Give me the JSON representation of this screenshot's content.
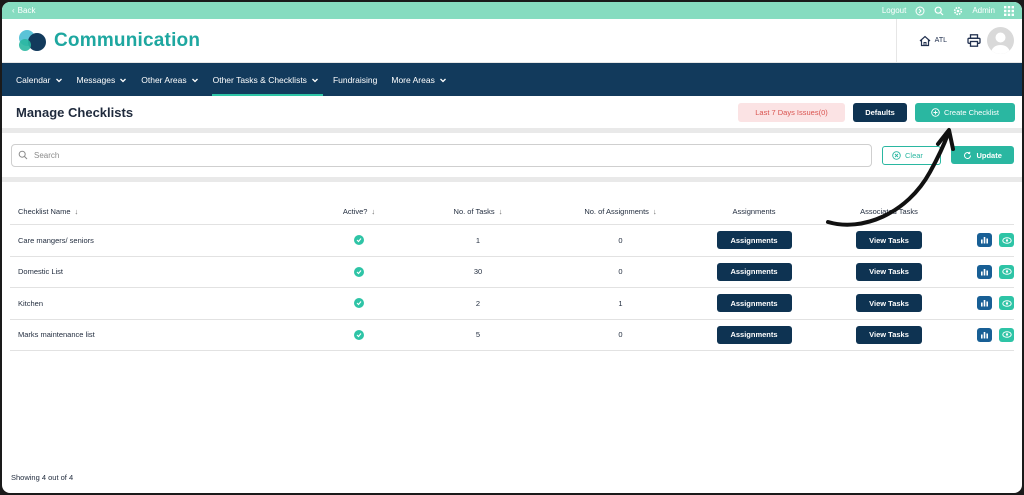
{
  "topbar": {
    "back": "Back",
    "logout": "Logout",
    "user": "Admin"
  },
  "brand": {
    "name": "Communication"
  },
  "header": {
    "site": "ATL"
  },
  "nav": [
    {
      "label": "Calendar",
      "dropdown": true
    },
    {
      "label": "Messages",
      "dropdown": true
    },
    {
      "label": "Other Areas",
      "dropdown": true
    },
    {
      "label": "Other Tasks & Checklists",
      "dropdown": true,
      "active": true
    },
    {
      "label": "Fundraising",
      "dropdown": false
    },
    {
      "label": "More Areas",
      "dropdown": true
    }
  ],
  "page": {
    "title": "Manage Checklists",
    "issues_label": "Last 7 Days Issues(0)",
    "defaults_label": "Defaults",
    "create_label": "Create Checklist"
  },
  "search": {
    "placeholder": "Search",
    "clear_label": "Clear",
    "update_label": "Update"
  },
  "table": {
    "headers": [
      "Checklist Name",
      "Active?",
      "No. of Tasks",
      "No. of Assignments",
      "Assignments",
      "Associated Tasks"
    ],
    "rows": [
      {
        "name": "Care mangers/ seniors",
        "active": true,
        "tasks": "1",
        "assignments": "0"
      },
      {
        "name": "Domestic List",
        "active": true,
        "tasks": "30",
        "assignments": "0"
      },
      {
        "name": "Kitchen",
        "active": true,
        "tasks": "2",
        "assignments": "1"
      },
      {
        "name": "Marks maintenance list",
        "active": true,
        "tasks": "5",
        "assignments": "0"
      }
    ],
    "assignments_btn": "Assignments",
    "view_tasks_btn": "View Tasks"
  },
  "footer": {
    "showing": "Showing 4 out of 4"
  },
  "colors": {
    "accent": "#2ab7a1",
    "navy": "#123a5c",
    "topbar": "#86dcc0",
    "brand": "#1ea7a0"
  }
}
